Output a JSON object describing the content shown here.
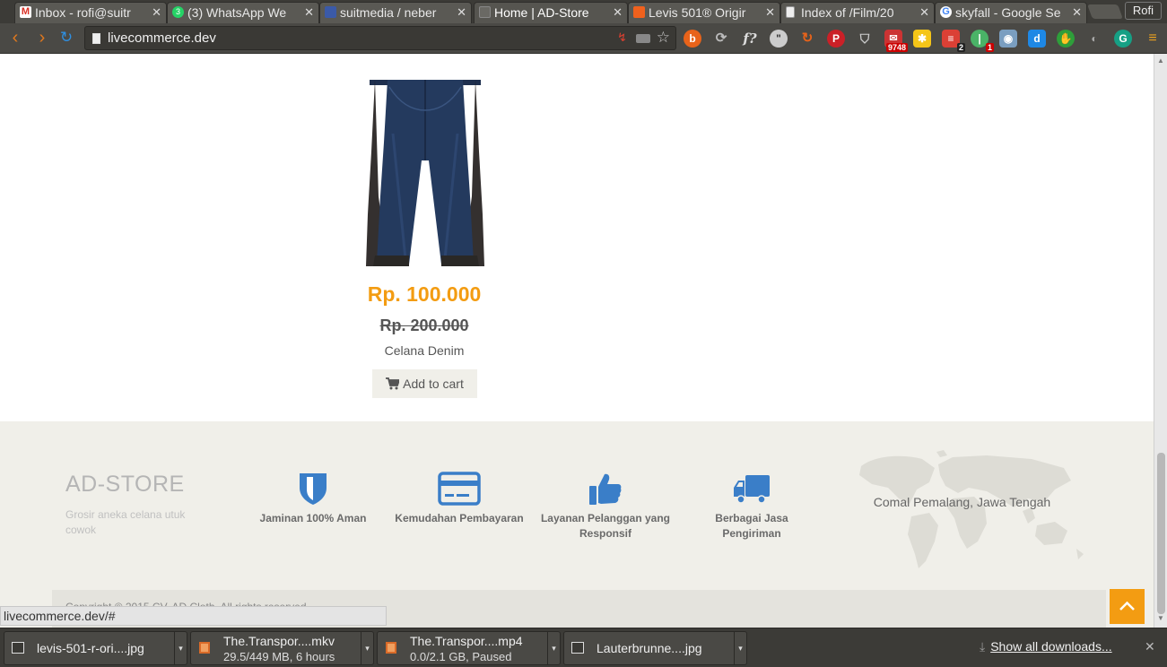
{
  "browser": {
    "tabs": [
      {
        "title": "Inbox - rofi@suitr",
        "favicon": "gmail-icon",
        "color": "#d93025"
      },
      {
        "title": "(3) WhatsApp We",
        "favicon": "whatsapp-icon",
        "color": "#25d366",
        "badge": "3"
      },
      {
        "title": "suitmedia / neber",
        "favicon": "gitlab-icon",
        "color": "#3b5aa8"
      },
      {
        "title": "Home | AD-Store",
        "favicon": "page-icon",
        "color": "#777777",
        "active": true
      },
      {
        "title": "Levis 501® Origir",
        "favicon": "store-icon",
        "color": "#f0611d"
      },
      {
        "title": "Index of /Film/20",
        "favicon": "page-icon",
        "color": "#aaaaaa"
      },
      {
        "title": "skyfall - Google Se",
        "favicon": "google-icon",
        "color": "#4285f4"
      }
    ],
    "profile_name": "Rofi",
    "url": "livecommerce.dev",
    "extension_badges": {
      "mail": "9748",
      "todo": "2",
      "pushbullet": "1"
    },
    "status_url": "livecommerce.dev/#"
  },
  "product": {
    "price": "Rp. 100.000",
    "old_price": "Rp. 200.000",
    "name": "Celana Denim",
    "add_to_cart_label": "Add to cart"
  },
  "footer": {
    "brand": "AD-STORE",
    "tagline": "Grosir aneka celana utuk cowok",
    "features": [
      {
        "label": "Jaminan 100% Aman",
        "icon": "shield-icon"
      },
      {
        "label": "Kemudahan Pembayaran",
        "icon": "credit-card-icon"
      },
      {
        "label": "Layanan Pelanggan yang Responsif",
        "icon": "thumbs-up-icon"
      },
      {
        "label": "Berbagai Jasa Pengiriman",
        "icon": "truck-icon"
      }
    ],
    "location": "Comal Pemalang, Jawa Tengah",
    "copyright": "Copyright © 2015 CV. AD Cloth. All rights reserved"
  },
  "downloads": {
    "items": [
      {
        "name": "levis-501-r-ori....jpg",
        "status": ""
      },
      {
        "name": "The.Transpor....mkv",
        "status": "29.5/449 MB, 6 hours"
      },
      {
        "name": "The.Transpor....mp4",
        "status": "0.0/2.1 GB, Paused"
      },
      {
        "name": "Lauterbrunne....jpg",
        "status": ""
      }
    ],
    "show_all_label": "Show all downloads..."
  },
  "colors": {
    "accent": "#f39c12",
    "feature_icon": "#3a7ec8",
    "footer_bg": "#f0efe9"
  }
}
